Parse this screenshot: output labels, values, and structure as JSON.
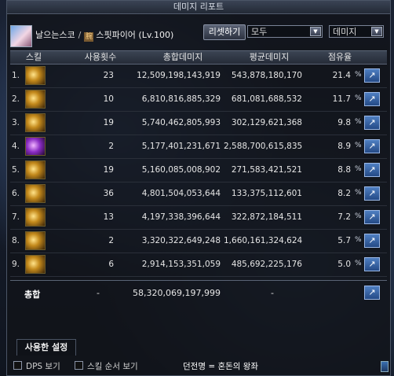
{
  "window": {
    "title": "데미지 리포트",
    "player_name": "날으는스코",
    "class_icon": "腕",
    "class_label": "스핏파이어 (Lv.100)",
    "reset_button": "리셋하기",
    "filter_target": "모두",
    "filter_metric": "데미지"
  },
  "columns": {
    "skill": "스킬",
    "uses": "사용횟수",
    "total": "총합데미지",
    "avg": "평균데미지",
    "share": "점유율"
  },
  "rows": [
    {
      "rank": "1.",
      "uses": "23",
      "total": "12,509,198,143,919",
      "avg": "543,878,180,170",
      "share": "21.4"
    },
    {
      "rank": "2.",
      "uses": "10",
      "total": "6,810,816,885,329",
      "avg": "681,081,688,532",
      "share": "11.7"
    },
    {
      "rank": "3.",
      "uses": "19",
      "total": "5,740,462,805,993",
      "avg": "302,129,621,368",
      "share": "9.8"
    },
    {
      "rank": "4.",
      "uses": "2",
      "total": "5,177,401,231,671",
      "avg": "2,588,700,615,835",
      "share": "8.9"
    },
    {
      "rank": "5.",
      "uses": "19",
      "total": "5,160,085,008,902",
      "avg": "271,583,421,521",
      "share": "8.8"
    },
    {
      "rank": "6.",
      "uses": "36",
      "total": "4,801,504,053,644",
      "avg": "133,375,112,601",
      "share": "8.2"
    },
    {
      "rank": "7.",
      "uses": "13",
      "total": "4,197,338,396,644",
      "avg": "322,872,184,511",
      "share": "7.2"
    },
    {
      "rank": "8.",
      "uses": "2",
      "total": "3,320,322,649,248",
      "avg": "1,660,161,324,624",
      "share": "5.7"
    },
    {
      "rank": "9.",
      "uses": "6",
      "total": "2,914,153,351,059",
      "avg": "485,692,225,176",
      "share": "5.0"
    }
  ],
  "totals": {
    "label": "총합",
    "uses": "-",
    "total": "58,320,069,197,999",
    "avg": "-"
  },
  "settings_tab": "사용한 설정",
  "bottom": {
    "dps_toggle": "DPS 보기",
    "skill_order_toggle": "스킬 순서 보기",
    "party_label": "던전명 = 혼돈의 왕좌"
  },
  "icons": {
    "share": "share-icon",
    "percent": "percent-icon",
    "dropdown": "chevron-down-icon"
  },
  "colors": {
    "accent_button": "#2f5fa6",
    "header_bg": "#2b3240"
  }
}
